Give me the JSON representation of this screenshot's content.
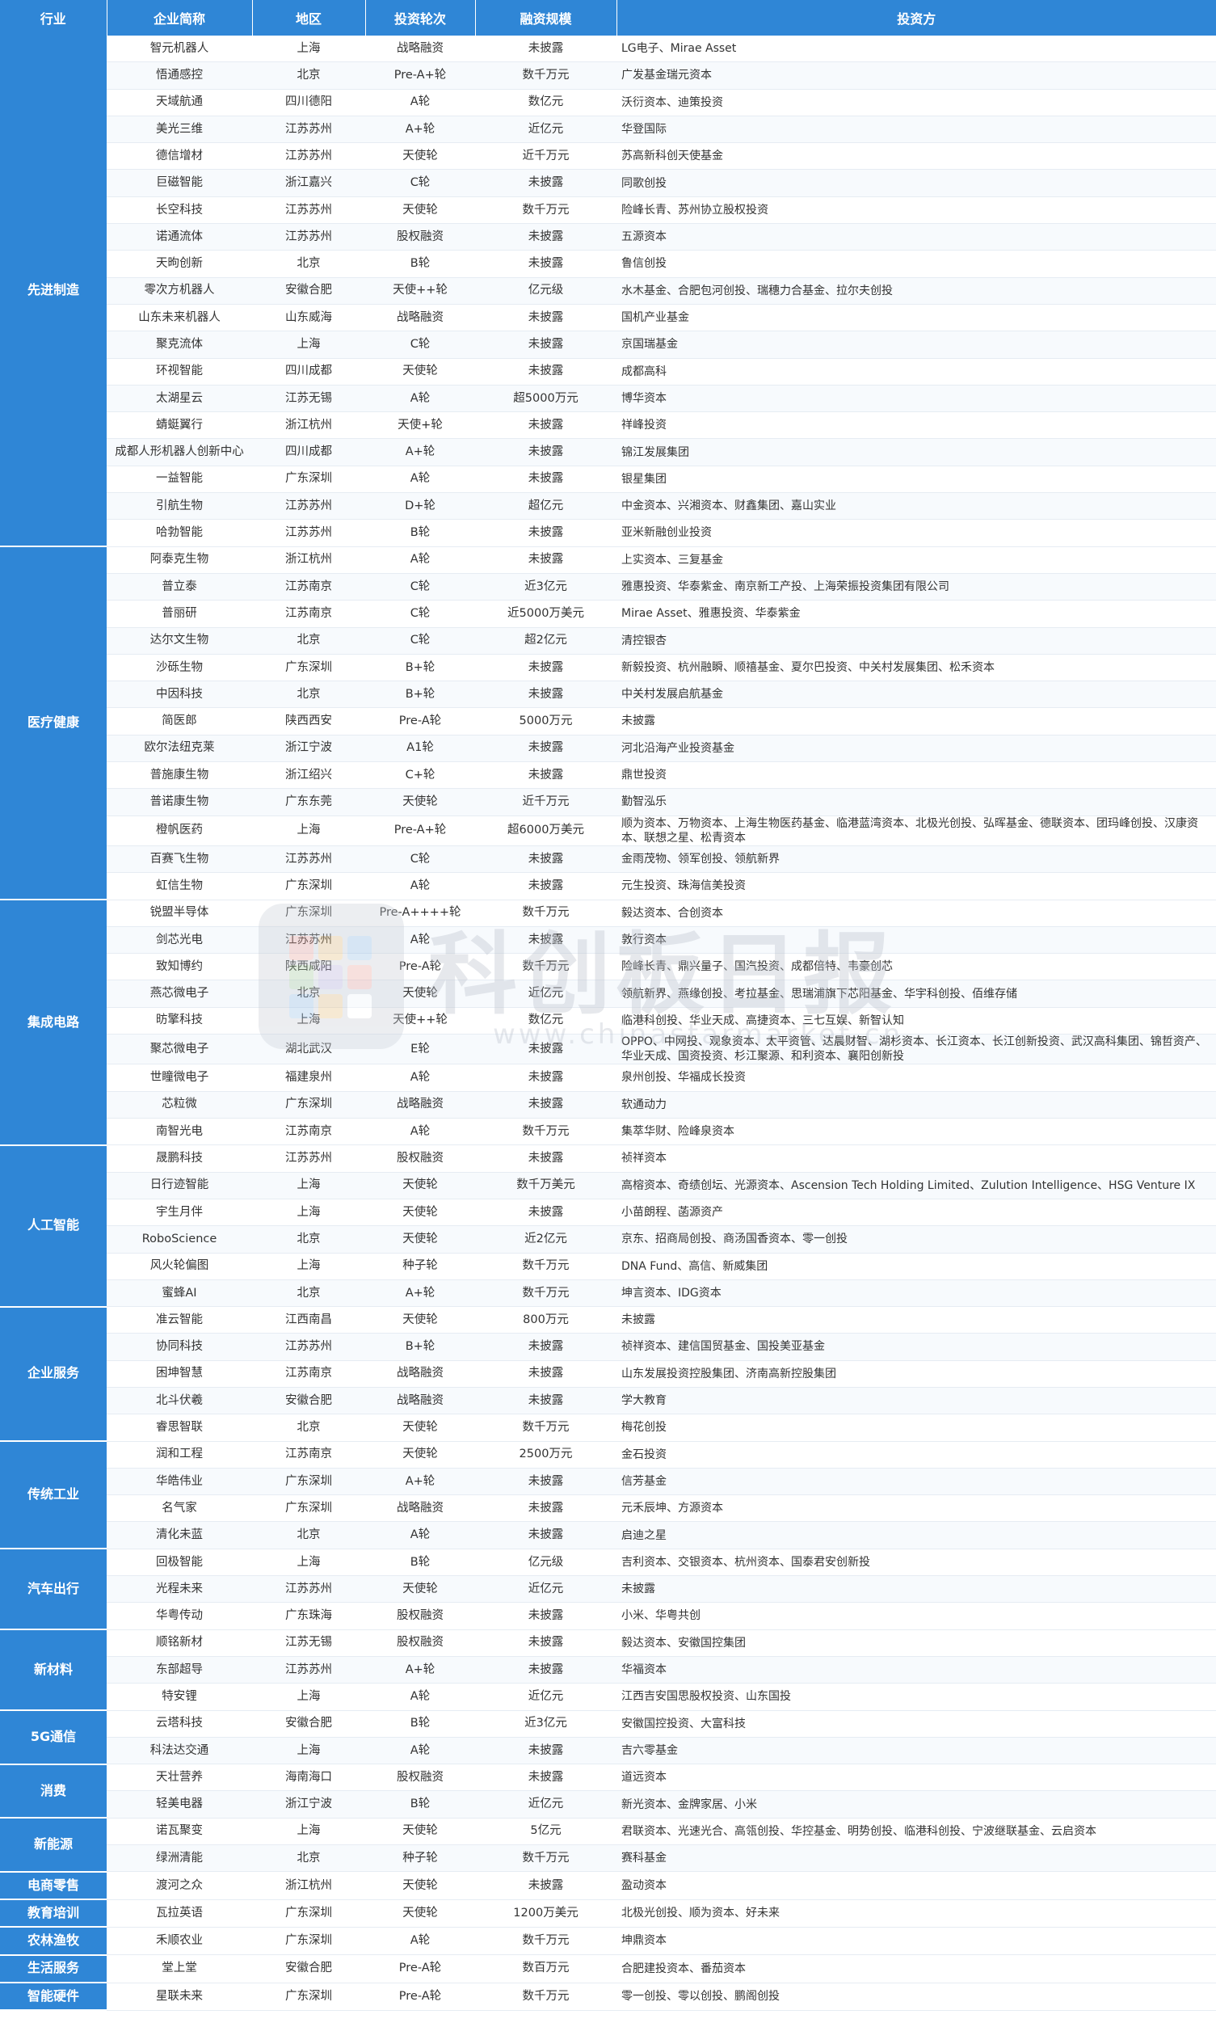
{
  "header": [
    "行业",
    "企业简称",
    "地区",
    "投资轮次",
    "融资规模",
    "投资方"
  ],
  "groups": [
    {
      "industry": "先进制造",
      "rows": [
        [
          "智元机器人",
          "上海",
          "战略融资",
          "未披露",
          "LG电子、Mirae Asset"
        ],
        [
          "悟通感控",
          "北京",
          "Pre-A+轮",
          "数千万元",
          "广发基金瑞元资本"
        ],
        [
          "天域航通",
          "四川德阳",
          "A轮",
          "数亿元",
          "沃衍资本、迪策投资"
        ],
        [
          "美光三维",
          "江苏苏州",
          "A+轮",
          "近亿元",
          "华登国际"
        ],
        [
          "德信增材",
          "江苏苏州",
          "天使轮",
          "近千万元",
          "苏高新科创天使基金"
        ],
        [
          "巨磁智能",
          "浙江嘉兴",
          "C轮",
          "未披露",
          "同歌创投"
        ],
        [
          "长空科技",
          "江苏苏州",
          "天使轮",
          "数千万元",
          "险峰长青、苏州协立股权投资"
        ],
        [
          "诺通流体",
          "江苏苏州",
          "股权融资",
          "未披露",
          "五源资本"
        ],
        [
          "天昫创新",
          "北京",
          "B轮",
          "未披露",
          "鲁信创投"
        ],
        [
          "零次方机器人",
          "安徽合肥",
          "天使++轮",
          "亿元级",
          "水木基金、合肥包河创投、瑞穗力合基金、拉尔夫创投"
        ],
        [
          "山东未来机器人",
          "山东威海",
          "战略融资",
          "未披露",
          "国机产业基金"
        ],
        [
          "聚克流体",
          "上海",
          "C轮",
          "未披露",
          "京国瑞基金"
        ],
        [
          "环视智能",
          "四川成都",
          "天使轮",
          "未披露",
          "成都高科"
        ],
        [
          "太湖星云",
          "江苏无锡",
          "A轮",
          "超5000万元",
          "博华资本"
        ],
        [
          "蜻蜓翼行",
          "浙江杭州",
          "天使+轮",
          "未披露",
          "祥峰投资"
        ],
        [
          "成都人形机器人创新中心",
          "四川成都",
          "A+轮",
          "未披露",
          "锦江发展集团"
        ],
        [
          "一益智能",
          "广东深圳",
          "A轮",
          "未披露",
          "银星集团"
        ],
        [
          "引航生物",
          "江苏苏州",
          "D+轮",
          "超亿元",
          "中金资本、兴湘资本、财鑫集团、嘉山实业"
        ],
        [
          "哈勃智能",
          "江苏苏州",
          "B轮",
          "未披露",
          "亚米新融创业投资"
        ]
      ]
    },
    {
      "industry": "医疗健康",
      "rows": [
        [
          "阿泰克生物",
          "浙江杭州",
          "A轮",
          "未披露",
          "上实资本、三复基金"
        ],
        [
          "普立泰",
          "江苏南京",
          "C轮",
          "近3亿元",
          "雅惠投资、华泰紫金、南京新工产投、上海荣振投资集团有限公司"
        ],
        [
          "普丽研",
          "江苏南京",
          "C轮",
          "近5000万美元",
          "Mirae Asset、雅惠投资、华泰紫金"
        ],
        [
          "达尔文生物",
          "北京",
          "C轮",
          "超2亿元",
          "清控银杏"
        ],
        [
          "沙砾生物",
          "广东深圳",
          "B+轮",
          "未披露",
          "新毅投资、杭州融瞬、顺禧基金、夏尔巴投资、中关村发展集团、松禾资本"
        ],
        [
          "中因科技",
          "北京",
          "B+轮",
          "未披露",
          "中关村发展启航基金"
        ],
        [
          "简医郎",
          "陕西西安",
          "Pre-A轮",
          "5000万元",
          "未披露"
        ],
        [
          "欧尔法纽克莱",
          "浙江宁波",
          "A1轮",
          "未披露",
          "河北沿海产业投资基金"
        ],
        [
          "普施康生物",
          "浙江绍兴",
          "C+轮",
          "未披露",
          "鼎世投资"
        ],
        [
          "普诺康生物",
          "广东东莞",
          "天使轮",
          "近千万元",
          "勤智泓乐"
        ],
        [
          "橙帆医药",
          "上海",
          "Pre-A+轮",
          "超6000万美元",
          "顺为资本、万物资本、上海生物医药基金、临港蓝湾资本、北极光创投、弘晖基金、德联资本、团玛峰创投、汉康资本、联想之星、松青资本"
        ],
        [
          "百赛飞生物",
          "江苏苏州",
          "C轮",
          "未披露",
          "金雨茂物、领军创投、领航新界"
        ],
        [
          "虹信生物",
          "广东深圳",
          "A轮",
          "未披露",
          "元生投资、珠海信美投资"
        ]
      ]
    },
    {
      "industry": "集成电路",
      "rows": [
        [
          "锐盟半导体",
          "广东深圳",
          "Pre-A++++轮",
          "数千万元",
          "毅达资本、合创资本"
        ],
        [
          "剑芯光电",
          "江苏苏州",
          "A轮",
          "未披露",
          "敦行资本"
        ],
        [
          "致知博约",
          "陕西咸阳",
          "Pre-A轮",
          "数千万元",
          "险峰长青、鼎兴量子、国汽投资、成都倍特、韦豪创芯"
        ],
        [
          "燕芯微电子",
          "北京",
          "天使轮",
          "近亿元",
          "领航新界、燕缘创投、考拉基金、思瑞浦旗下芯阳基金、华宇科创投、佰维存储"
        ],
        [
          "昉擎科技",
          "上海",
          "天使++轮",
          "数亿元",
          "临港科创投、华业天成、高捷资本、三七互娱、新智认知"
        ],
        [
          "聚芯微电子",
          "湖北武汉",
          "E轮",
          "未披露",
          "OPPO、中网投、观象资本、太平资管、达晨财智、湖杉资本、长江资本、长江创新投资、武汉高科集团、锦哲资产、华业天成、国资投资、杉江聚源、和利资本、襄阳创新投"
        ],
        [
          "世瞳微电子",
          "福建泉州",
          "A轮",
          "未披露",
          "泉州创投、华福成长投资"
        ],
        [
          "芯粒微",
          "广东深圳",
          "战略融资",
          "未披露",
          "软通动力"
        ],
        [
          "南智光电",
          "江苏南京",
          "A轮",
          "数千万元",
          "集萃华财、险峰泉资本"
        ]
      ]
    },
    {
      "industry": "人工智能",
      "rows": [
        [
          "晟鹏科技",
          "江苏苏州",
          "股权融资",
          "未披露",
          "祯祥资本"
        ],
        [
          "日行迹智能",
          "上海",
          "天使轮",
          "数千万美元",
          "高榕资本、奇绩创坛、光源资本、Ascension Tech Holding Limited、Zulution Intelligence、HSG Venture IX"
        ],
        [
          "宇生月伴",
          "上海",
          "天使轮",
          "未披露",
          "小苗朗程、菡源资产"
        ],
        [
          "RoboScience",
          "北京",
          "天使轮",
          "近2亿元",
          "京东、招商局创投、商汤国香资本、零一创投"
        ],
        [
          "风火轮偏图",
          "上海",
          "种子轮",
          "数千万元",
          "DNA Fund、高信、新威集团"
        ],
        [
          "蜜蜂AI",
          "北京",
          "A+轮",
          "数千万元",
          "坤言资本、IDG资本"
        ]
      ]
    },
    {
      "industry": "企业服务",
      "rows": [
        [
          "准云智能",
          "江西南昌",
          "天使轮",
          "800万元",
          "未披露"
        ],
        [
          "协同科技",
          "江苏苏州",
          "B+轮",
          "未披露",
          "祯祥资本、建信国贸基金、国投美亚基金"
        ],
        [
          "困坤智慧",
          "江苏南京",
          "战略融资",
          "未披露",
          "山东发展投资控股集团、济南高新控股集团"
        ],
        [
          "北斗伏羲",
          "安徽合肥",
          "战略融资",
          "未披露",
          "学大教育"
        ],
        [
          "睿思智联",
          "北京",
          "天使轮",
          "数千万元",
          "梅花创投"
        ]
      ]
    },
    {
      "industry": "传统工业",
      "rows": [
        [
          "润和工程",
          "江苏南京",
          "天使轮",
          "2500万元",
          "金石投资"
        ],
        [
          "华皓伟业",
          "广东深圳",
          "A+轮",
          "未披露",
          "信芳基金"
        ],
        [
          "名气家",
          "广东深圳",
          "战略融资",
          "未披露",
          "元禾辰坤、方源资本"
        ],
        [
          "清化未蓝",
          "北京",
          "A轮",
          "未披露",
          "启迪之星"
        ]
      ]
    },
    {
      "industry": "汽车出行",
      "rows": [
        [
          "回极智能",
          "上海",
          "B轮",
          "亿元级",
          "吉利资本、交银资本、杭州资本、国泰君安创新投"
        ],
        [
          "光程未来",
          "江苏苏州",
          "天使轮",
          "近亿元",
          "未披露"
        ],
        [
          "华粤传动",
          "广东珠海",
          "股权融资",
          "未披露",
          "小米、华粤共创"
        ]
      ]
    },
    {
      "industry": "新材料",
      "rows": [
        [
          "顺铭新材",
          "江苏无锡",
          "股权融资",
          "未披露",
          "毅达资本、安徽国控集团"
        ],
        [
          "东部超导",
          "江苏苏州",
          "A+轮",
          "未披露",
          "华福资本"
        ],
        [
          "特安锂",
          "上海",
          "A轮",
          "近亿元",
          "江西吉安国思股权投资、山东国投"
        ]
      ]
    },
    {
      "industry": "5G通信",
      "rows": [
        [
          "云塔科技",
          "安徽合肥",
          "B轮",
          "近3亿元",
          "安徽国控投资、大富科技"
        ],
        [
          "科法达交通",
          "上海",
          "A轮",
          "未披露",
          "吉六零基金"
        ]
      ]
    },
    {
      "industry": "消费",
      "rows": [
        [
          "天壮营养",
          "海南海口",
          "股权融资",
          "未披露",
          "道远资本"
        ],
        [
          "轻美电器",
          "浙江宁波",
          "B轮",
          "近亿元",
          "新光资本、金牌家居、小米"
        ]
      ]
    },
    {
      "industry": "新能源",
      "rows": [
        [
          "诺瓦聚变",
          "上海",
          "天使轮",
          "5亿元",
          "君联资本、光速光合、高瓴创投、华控基金、明势创投、临港科创投、宁波继联基金、云启资本"
        ],
        [
          "绿洲清能",
          "北京",
          "种子轮",
          "数千万元",
          "赛科基金"
        ]
      ]
    },
    {
      "industry": "电商零售",
      "rows": [
        [
          "渡河之众",
          "浙江杭州",
          "天使轮",
          "未披露",
          "盈动资本"
        ]
      ]
    },
    {
      "industry": "教育培训",
      "rows": [
        [
          "瓦拉英语",
          "广东深圳",
          "天使轮",
          "1200万美元",
          "北极光创投、顺为资本、好未来"
        ]
      ]
    },
    {
      "industry": "农林渔牧",
      "rows": [
        [
          "禾顺农业",
          "广东深圳",
          "A轮",
          "数千万元",
          "坤鼎资本"
        ]
      ]
    },
    {
      "industry": "生活服务",
      "rows": [
        [
          "堂上堂",
          "安徽合肥",
          "Pre-A轮",
          "数百万元",
          "合肥建投资本、番茄资本"
        ]
      ]
    },
    {
      "industry": "智能硬件",
      "rows": [
        [
          "星联未来",
          "广东深圳",
          "Pre-A轮",
          "数千万元",
          "零一创投、零以创投、鹏阁创投"
        ]
      ]
    }
  ],
  "watermark": {
    "brand": "科创板日报",
    "url": "www.chinastarmarket.cn"
  },
  "colors": {
    "header_bg": "#2f86d6",
    "header_text": "#ffffff",
    "row_divider": "#e6ecf3"
  }
}
